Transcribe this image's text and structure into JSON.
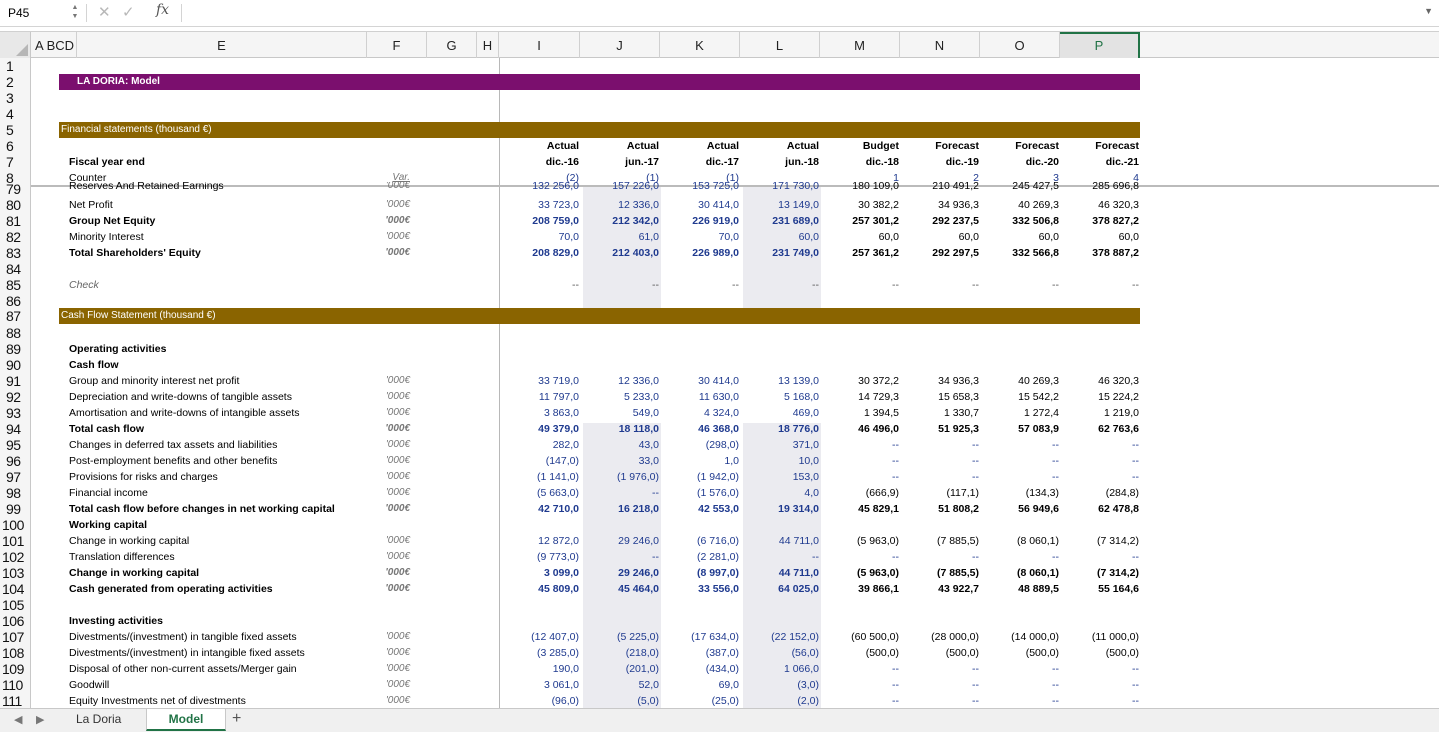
{
  "formula_bar": {
    "cell_ref": "P45",
    "fx_label": "fx",
    "formula": ""
  },
  "columns": [
    "A",
    "B",
    "C",
    "D",
    "E",
    "F",
    "G",
    "H",
    "I",
    "J",
    "K",
    "L",
    "M",
    "N",
    "O",
    "P"
  ],
  "column_header_text": {
    "abcd": "A BCD",
    "E": "E",
    "F": "F",
    "G": "G",
    "H": "H",
    "I": "I",
    "J": "J",
    "K": "K",
    "L": "L",
    "M": "M",
    "N": "N",
    "O": "O",
    "P": "P"
  },
  "colors": {
    "title_band": "#7b0f6e",
    "section_band": "#8a6400",
    "selected": "#217346"
  },
  "title": "LA DORIA: Model",
  "section_financial": "Financial statements (thousand €)",
  "section_cashflow": "Cash Flow Statement (thousand €)",
  "header": {
    "types": [
      "Actual",
      "Actual",
      "Actual",
      "Actual",
      "Budget",
      "Forecast",
      "Forecast",
      "Forecast"
    ],
    "periods": [
      "dic.-16",
      "jun.-17",
      "dic.-17",
      "jun.-18",
      "dic.-18",
      "dic.-19",
      "dic.-20",
      "dic.-21"
    ],
    "counter": [
      "(2)",
      "(1)",
      "(1)",
      "",
      "1",
      "2",
      "3",
      "4"
    ],
    "fiscal_label": "Fiscal year end",
    "counter_label": "Counter",
    "var_label": "Var."
  },
  "row_numbers": [
    "1",
    "2",
    "3",
    "4",
    "5",
    "6",
    "7",
    "8",
    "79",
    "80",
    "81",
    "82",
    "83",
    "84",
    "85",
    "86",
    "87",
    "88",
    "89",
    "90",
    "91",
    "92",
    "93",
    "94",
    "95",
    "96",
    "97",
    "98",
    "99",
    "100",
    "101",
    "102",
    "103",
    "104",
    "105",
    "106",
    "107",
    "108",
    "109",
    "110",
    "111"
  ],
  "rows": [
    {
      "r": "79",
      "label": "Reserves And Retained Earnings",
      "bold": false,
      "var": "'000€",
      "values": [
        "132 256,0",
        "157 226,0",
        "153 725,0",
        "171 730,0",
        "180 109,0",
        "210 491,2",
        "245 427,5",
        "285 696,8"
      ]
    },
    {
      "r": "80",
      "label": "Net Profit",
      "bold": false,
      "var": "'000€",
      "values": [
        "33 723,0",
        "12 336,0",
        "30 414,0",
        "13 149,0",
        "30 382,2",
        "34 936,3",
        "40 269,3",
        "46 320,3"
      ]
    },
    {
      "r": "81",
      "label": "Group Net Equity",
      "bold": true,
      "var": "'000€",
      "values": [
        "208 759,0",
        "212 342,0",
        "226 919,0",
        "231 689,0",
        "257 301,2",
        "292 237,5",
        "332 506,8",
        "378 827,2"
      ]
    },
    {
      "r": "82",
      "label": "Minority Interest",
      "bold": false,
      "var": "'000€",
      "values": [
        "70,0",
        "61,0",
        "70,0",
        "60,0",
        "60,0",
        "60,0",
        "60,0",
        "60,0"
      ]
    },
    {
      "r": "83",
      "label": "Total Shareholders' Equity",
      "bold": true,
      "var": "'000€",
      "values": [
        "208 829,0",
        "212 403,0",
        "226 989,0",
        "231 749,0",
        "257 361,2",
        "292 297,5",
        "332 566,8",
        "378 887,2"
      ]
    },
    {
      "r": "85",
      "label": "Check",
      "bold": false,
      "italic": true,
      "var": "",
      "values": [
        "--",
        "--",
        "--",
        "--",
        "--",
        "--",
        "--",
        "--"
      ]
    },
    {
      "r": "89",
      "label": "Operating activities",
      "bold": true,
      "var": "",
      "values": [
        "",
        "",
        "",
        "",
        "",
        "",
        "",
        ""
      ]
    },
    {
      "r": "90",
      "label": "Cash flow",
      "bold": true,
      "var": "",
      "values": [
        "",
        "",
        "",
        "",
        "",
        "",
        "",
        ""
      ]
    },
    {
      "r": "91",
      "label": "Group and minority interest net profit",
      "bold": false,
      "var": "'000€",
      "values": [
        "33 719,0",
        "12 336,0",
        "30 414,0",
        "13 139,0",
        "30 372,2",
        "34 936,3",
        "40 269,3",
        "46 320,3"
      ]
    },
    {
      "r": "92",
      "label": "Depreciation and write-downs of tangible assets",
      "bold": false,
      "var": "'000€",
      "values": [
        "11 797,0",
        "5 233,0",
        "11 630,0",
        "5 168,0",
        "14 729,3",
        "15 658,3",
        "15 542,2",
        "15 224,2"
      ]
    },
    {
      "r": "93",
      "label": "Amortisation and write-downs of intangible assets",
      "bold": false,
      "var": "'000€",
      "values": [
        "3 863,0",
        "549,0",
        "4 324,0",
        "469,0",
        "1 394,5",
        "1 330,7",
        "1 272,4",
        "1 219,0"
      ]
    },
    {
      "r": "94",
      "label": "Total cash flow",
      "bold": true,
      "var": "'000€",
      "values": [
        "49 379,0",
        "18 118,0",
        "46 368,0",
        "18 776,0",
        "46 496,0",
        "51 925,3",
        "57 083,9",
        "62 763,6"
      ]
    },
    {
      "r": "95",
      "label": "Changes in deferred tax assets and liabilities",
      "bold": false,
      "var": "'000€",
      "values": [
        "282,0",
        "43,0",
        "(298,0)",
        "371,0",
        "--",
        "--",
        "--",
        "--"
      ]
    },
    {
      "r": "96",
      "label": "Post-employment benefits and other benefits",
      "bold": false,
      "var": "'000€",
      "values": [
        "(147,0)",
        "33,0",
        "1,0",
        "10,0",
        "--",
        "--",
        "--",
        "--"
      ]
    },
    {
      "r": "97",
      "label": "Provisions for risks and charges",
      "bold": false,
      "var": "'000€",
      "values": [
        "(1 141,0)",
        "(1 976,0)",
        "(1 942,0)",
        "153,0",
        "--",
        "--",
        "--",
        "--"
      ]
    },
    {
      "r": "98",
      "label": "Financial income",
      "bold": false,
      "var": "'000€",
      "values": [
        "(5 663,0)",
        "--",
        "(1 576,0)",
        "4,0",
        "(666,9)",
        "(117,1)",
        "(134,3)",
        "(284,8)"
      ]
    },
    {
      "r": "99",
      "label": "Total cash flow before changes in net working capital",
      "bold": true,
      "var": "'000€",
      "values": [
        "42 710,0",
        "16 218,0",
        "42 553,0",
        "19 314,0",
        "45 829,1",
        "51 808,2",
        "56 949,6",
        "62 478,8"
      ]
    },
    {
      "r": "100",
      "label": "Working capital",
      "bold": true,
      "var": "",
      "values": [
        "",
        "",
        "",
        "",
        "",
        "",
        "",
        ""
      ]
    },
    {
      "r": "101",
      "label": "Change in working capital",
      "bold": false,
      "var": "'000€",
      "values": [
        "12 872,0",
        "29 246,0",
        "(6 716,0)",
        "44 711,0",
        "(5 963,0)",
        "(7 885,5)",
        "(8 060,1)",
        "(7 314,2)"
      ]
    },
    {
      "r": "102",
      "label": "Translation differences",
      "bold": false,
      "var": "'000€",
      "values": [
        "(9 773,0)",
        "--",
        "(2 281,0)",
        "--",
        "--",
        "--",
        "--",
        "--"
      ]
    },
    {
      "r": "103",
      "label": "Change in working capital",
      "bold": true,
      "var": "'000€",
      "values": [
        "3 099,0",
        "29 246,0",
        "(8 997,0)",
        "44 711,0",
        "(5 963,0)",
        "(7 885,5)",
        "(8 060,1)",
        "(7 314,2)"
      ]
    },
    {
      "r": "104",
      "label": "Cash generated from operating activities",
      "bold": true,
      "var": "'000€",
      "values": [
        "45 809,0",
        "45 464,0",
        "33 556,0",
        "64 025,0",
        "39 866,1",
        "43 922,7",
        "48 889,5",
        "55 164,6"
      ]
    },
    {
      "r": "106",
      "label": "Investing activities",
      "bold": true,
      "var": "",
      "values": [
        "",
        "",
        "",
        "",
        "",
        "",
        "",
        ""
      ]
    },
    {
      "r": "107",
      "label": "Divestments/(investment) in tangible fixed assets",
      "bold": false,
      "var": "'000€",
      "values": [
        "(12 407,0)",
        "(5 225,0)",
        "(17 634,0)",
        "(22 152,0)",
        "(60 500,0)",
        "(28 000,0)",
        "(14 000,0)",
        "(11 000,0)"
      ]
    },
    {
      "r": "108",
      "label": "Divestments/(investment) in intangible fixed assets",
      "bold": false,
      "var": "'000€",
      "values": [
        "(3 285,0)",
        "(218,0)",
        "(387,0)",
        "(56,0)",
        "(500,0)",
        "(500,0)",
        "(500,0)",
        "(500,0)"
      ]
    },
    {
      "r": "109",
      "label": "Disposal of other non-current assets/Merger gain",
      "bold": false,
      "var": "'000€",
      "values": [
        "190,0",
        "(201,0)",
        "(434,0)",
        "1 066,0",
        "--",
        "--",
        "--",
        "--"
      ]
    },
    {
      "r": "110",
      "label": "Goodwill",
      "bold": false,
      "var": "'000€",
      "values": [
        "3 061,0",
        "52,0",
        "69,0",
        "(3,0)",
        "--",
        "--",
        "--",
        "--"
      ]
    },
    {
      "r": "111",
      "label": "Equity Investments net of divestments",
      "bold": false,
      "var": "'000€",
      "values": [
        "(96,0)",
        "(5,0)",
        "(25,0)",
        "(2,0)",
        "--",
        "--",
        "--",
        "--"
      ]
    }
  ],
  "sheet_tabs": {
    "tab1": "La Doria",
    "tab2": "Model",
    "add": "+"
  }
}
